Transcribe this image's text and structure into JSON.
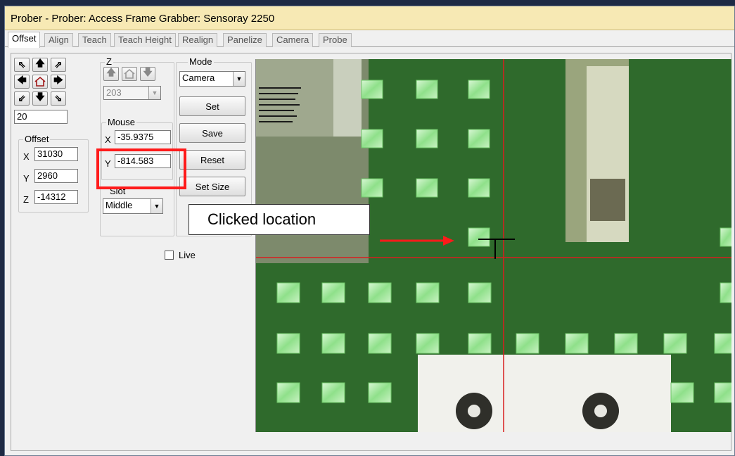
{
  "window": {
    "title": "Prober - Prober: Access Frame Grabber: Sensoray 2250"
  },
  "tabs": [
    "Offset",
    "Align",
    "Teach",
    "Teach Height",
    "Realign",
    "Panelize",
    "Camera",
    "Probe"
  ],
  "jog": {
    "step": "20"
  },
  "offset": {
    "label": "Offset",
    "x_label": "X",
    "x": "31030",
    "y_label": "Y",
    "y": "2960",
    "z_label": "Z",
    "z": "-14312"
  },
  "z_group": {
    "label": "Z",
    "value": "203"
  },
  "mouse": {
    "label": "Mouse",
    "x_label": "X",
    "x": "-35.9375",
    "y_label": "Y",
    "y": "-814.583"
  },
  "slot": {
    "label": "Slot",
    "value": "Middle"
  },
  "mode": {
    "label": "Mode",
    "value": "Camera",
    "set": "Set",
    "save": "Save",
    "reset": "Reset",
    "set_size": "Set Size"
  },
  "live": {
    "label": "Live",
    "checked": false
  },
  "annotation": {
    "text": "Clicked location"
  },
  "colors": {
    "highlight": "#ff1a1a",
    "crosshair": "#d81e1e",
    "pad": "#9fe6a0",
    "board": "#2f6a2c"
  }
}
